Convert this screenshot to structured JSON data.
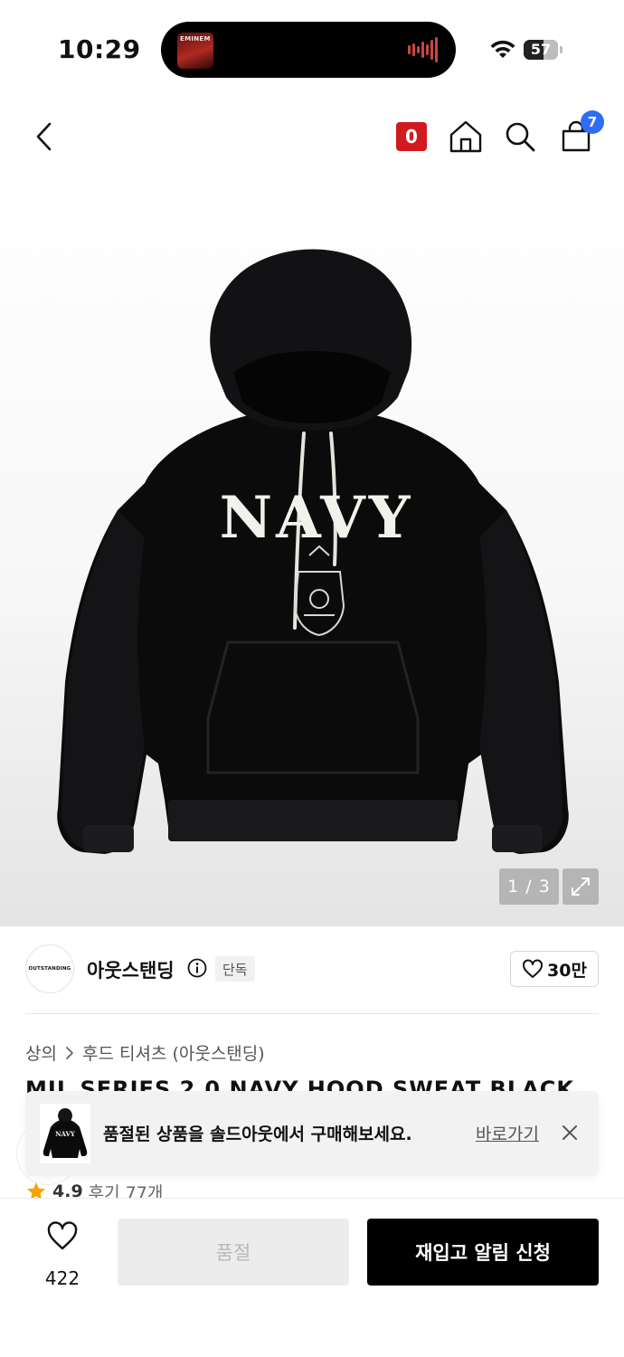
{
  "status_bar": {
    "time": "10:29",
    "album_text": "EMINEM",
    "battery": "57",
    "battery_fraction": 0.57
  },
  "header": {
    "badge_count": "0",
    "cart_count": "7",
    "badge_color": "#d11a1f",
    "cart_badge_color": "#2f6df6"
  },
  "gallery": {
    "counter": "1 / 3",
    "current": 1,
    "total": 3,
    "print_text": "NAVY"
  },
  "brand": {
    "logo_text": "OUTSTANDING",
    "name": "아웃스탠딩",
    "exclusive_label": "단독",
    "likes": "30만"
  },
  "breadcrumb": {
    "category": "상의",
    "subcategory": "후드 티셔츠 (아웃스탠딩)"
  },
  "product": {
    "title": "MIL SERIES 2.0 NAVY HOOD SWEAT BLACK"
  },
  "rating": {
    "score": "4.9",
    "reviews": "후기 77개"
  },
  "toast": {
    "message": "품절된 상품을 솔드아웃에서 구매해보세요.",
    "link": "바로가기"
  },
  "bottom_bar": {
    "wish_count": "422",
    "soldout_label": "품절",
    "restock_label": "재입고 알림 신청"
  }
}
